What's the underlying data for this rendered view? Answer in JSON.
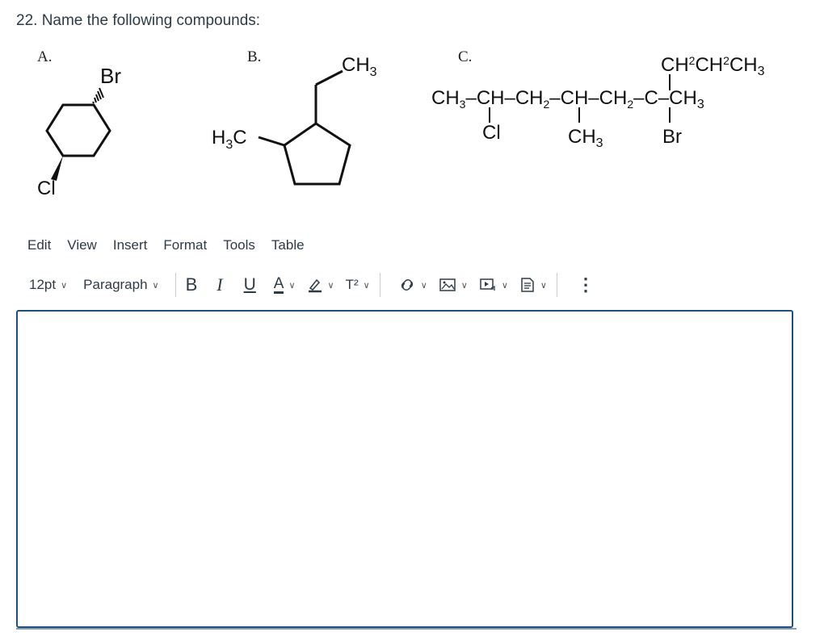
{
  "question": {
    "text": "22. Name the following compounds:"
  },
  "compounds": {
    "a": {
      "label": "A.",
      "substituent_top": "Br",
      "substituent_bottom": "Cl"
    },
    "b": {
      "label": "B.",
      "methyl_top": "CH3",
      "methyl_left": "H3C"
    },
    "c": {
      "label": "C.",
      "top_chain": "CH2CH2CH3",
      "main_chain": "CH3–CH–CH2–CH–CH2–C–CH3",
      "sub_cl": "Cl",
      "sub_ch3": "CH3",
      "sub_br": "Br"
    }
  },
  "menu": {
    "items": [
      "Edit",
      "View",
      "Insert",
      "Format",
      "Tools",
      "Table"
    ]
  },
  "toolbar": {
    "font_size": "12pt",
    "paragraph": "Paragraph",
    "bold": "B",
    "italic": "I",
    "underline": "U",
    "text_color": "A",
    "superscript": "T²",
    "more": "⋮"
  },
  "colors": {
    "editor_border": "#1f4f7d",
    "text": "#2d3b45"
  }
}
